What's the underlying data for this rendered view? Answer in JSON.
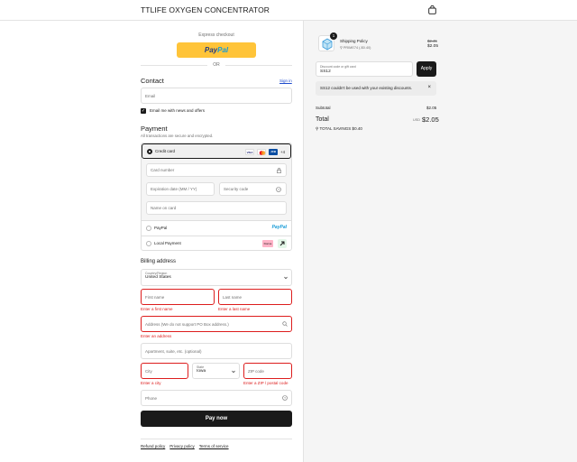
{
  "header": {
    "store_name": "TTLIFE OXYGEN CONCENTRATOR",
    "cart_icon": "shopping-bag-icon"
  },
  "express": {
    "label": "Express checkout",
    "paypal_part1": "Pay",
    "paypal_part2": "Pal",
    "or": "OR"
  },
  "contact": {
    "title": "Contact",
    "sign_in": "Sign in",
    "email_placeholder": "Email",
    "news_label": "Email me with news and offers"
  },
  "payment": {
    "title": "Payment",
    "subtitle": "All transactions are secure and encrypted.",
    "credit_card_label": "Credit card",
    "card_icons": [
      "VISA",
      "MC",
      "JCB"
    ],
    "more_cards": "+4",
    "card_number": "Card number",
    "expiration": "Expiration date (MM / YY)",
    "security_code": "Security code",
    "name_on_card": "Name on card",
    "paypal_label": "PayPal",
    "paypal_logo": "PayPal",
    "local_label": "Local Payment",
    "klarna": "Klarna"
  },
  "billing": {
    "title": "Billing address",
    "country_label": "Country/Region",
    "country_value": "United States",
    "first_name": "First name",
    "last_name": "Last name",
    "first_err": "Enter a first name",
    "last_err": "Enter a last name",
    "address": "Address (We do not support PO Box address.)",
    "address_err": "Enter an address",
    "apartment": "Apartment, suite, etc. (optional)",
    "city": "City",
    "city_err": "Enter a city",
    "state_label": "State",
    "state_value": "Iowa",
    "zip": "ZIP code",
    "zip_err": "Enter a ZIP / postal code",
    "phone": "Phone"
  },
  "pay_now": "Pay now",
  "footer": {
    "refund": "Refund policy",
    "privacy": "Privacy policy",
    "terms": "Terms of service"
  },
  "summary": {
    "product_qty": "1",
    "product_name": "Shipping Policy",
    "discount_tag": "PRIME74 (-$0.40)",
    "price_old": "$2.45",
    "price_new": "$2.05",
    "discount_label": "Discount code or gift card",
    "discount_value": "SS12",
    "apply": "Apply",
    "notice": "SS12 couldn't be used with your existing discounts.",
    "subtotal_label": "Subtotal",
    "subtotal_value": "$2.05",
    "total_label": "Total",
    "currency": "USD",
    "total_value": "$2.05",
    "savings": "TOTAL SAVINGS  $0.40"
  }
}
